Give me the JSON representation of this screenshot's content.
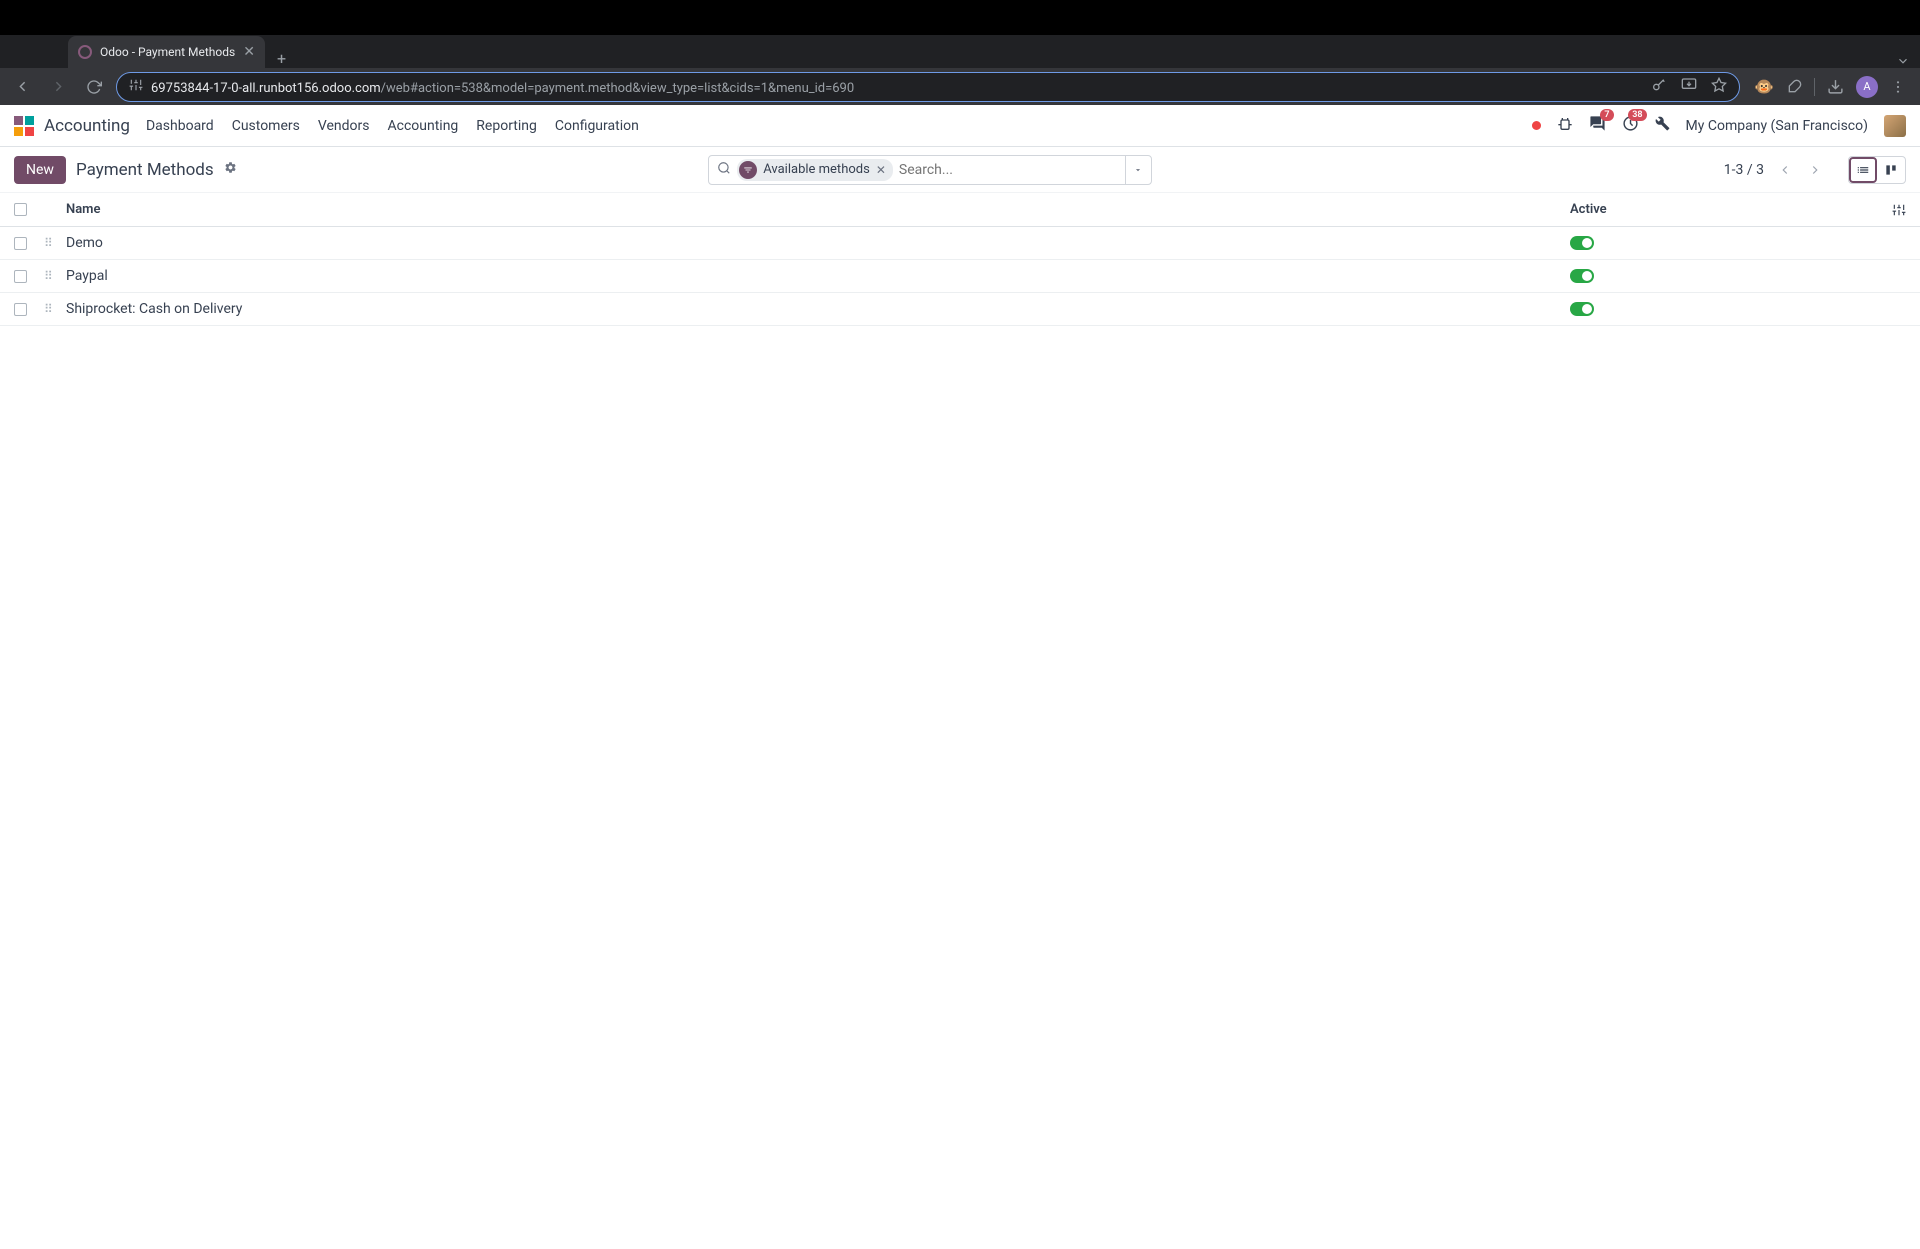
{
  "browser": {
    "tab_title": "Odoo - Payment Methods",
    "url_host": "69753844-17-0-all.runbot156.odoo.com",
    "url_path": "/web#action=538&model=payment.method&view_type=list&cids=1&menu_id=690",
    "profile_letter": "A"
  },
  "header": {
    "app_name": "Accounting",
    "menu": [
      "Dashboard",
      "Customers",
      "Vendors",
      "Accounting",
      "Reporting",
      "Configuration"
    ],
    "messaging_badge": "7",
    "activity_badge": "38",
    "company": "My Company (San Francisco)"
  },
  "control": {
    "new_label": "New",
    "breadcrumb": "Payment Methods",
    "filter_chip": "Available methods",
    "search_placeholder": "Search...",
    "pager": "1-3 / 3"
  },
  "table": {
    "columns": {
      "name": "Name",
      "active": "Active"
    },
    "rows": [
      {
        "name": "Demo",
        "active": true
      },
      {
        "name": "Paypal",
        "active": true
      },
      {
        "name": "Shiprocket: Cash on Delivery",
        "active": true
      }
    ]
  }
}
